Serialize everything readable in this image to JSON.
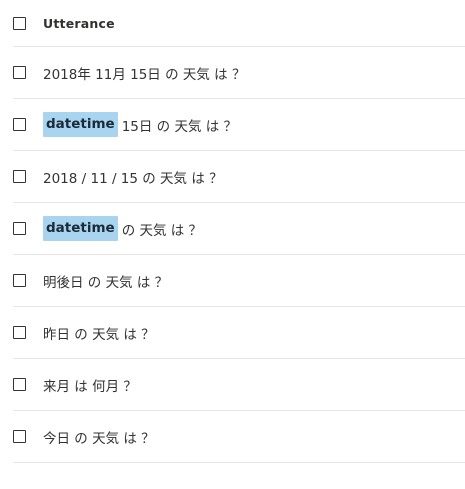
{
  "header": {
    "column_label": "Utterance"
  },
  "utterances": [
    {
      "entity": null,
      "text": "2018年 11月 15日 の 天気 は ？"
    },
    {
      "entity": "datetime",
      "text": "15日 の 天気 は ？"
    },
    {
      "entity": null,
      "text": "2018 / 11 / 15 の 天気 は ？"
    },
    {
      "entity": "datetime",
      "text": "の 天気 は ？"
    },
    {
      "entity": null,
      "text": "明後日 の 天気 は ？"
    },
    {
      "entity": null,
      "text": "昨日 の 天気 は ？"
    },
    {
      "entity": null,
      "text": "来月 は 何月 ？"
    },
    {
      "entity": null,
      "text": "今日 の 天気 は ？"
    }
  ],
  "colors": {
    "entity_highlight": "#a9d4ef",
    "divider": "#e6e6e6",
    "text": "#333333"
  }
}
